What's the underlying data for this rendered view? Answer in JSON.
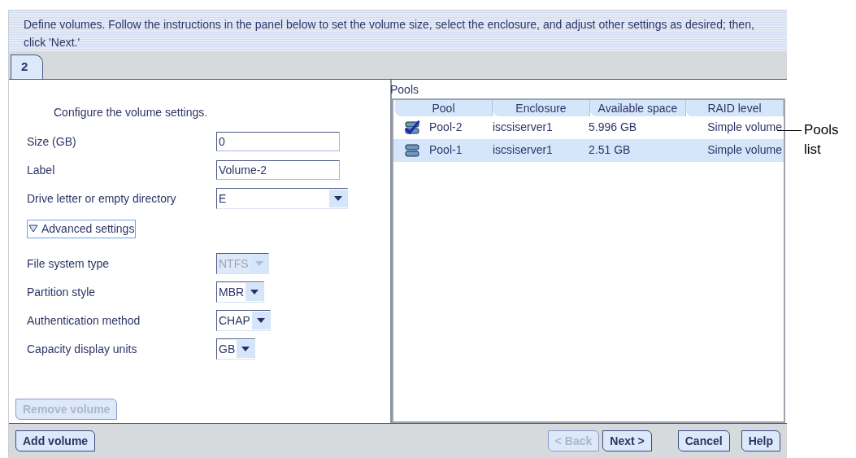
{
  "instructions": "Define volumes.  Follow the instructions in the panel below to set the volume size, select the enclosure, and adjust other settings as desired; then, click 'Next.'",
  "tabs": [
    {
      "label": "2",
      "selected": true
    }
  ],
  "settings": {
    "heading": "Configure the volume settings.",
    "fields": [
      {
        "kind": "text",
        "label": "Size (GB)",
        "value": "0"
      },
      {
        "kind": "text",
        "label": "Label",
        "value": "Volume-2"
      },
      {
        "kind": "dropdown",
        "label": "Drive letter or empty directory",
        "value": "E",
        "disabled": false
      }
    ],
    "advanced": {
      "label": "Advanced settings",
      "expanded": true,
      "fields": [
        {
          "kind": "dropdown",
          "label": "File system type",
          "value": "NTFS",
          "disabled": true
        },
        {
          "kind": "dropdown",
          "label": "Partition style",
          "value": "MBR",
          "disabled": false
        },
        {
          "kind": "dropdown",
          "label": "Authentication method",
          "value": "CHAP",
          "disabled": false
        },
        {
          "kind": "dropdown",
          "label": "Capacity display units",
          "value": "GB",
          "disabled": false
        }
      ]
    },
    "remove_button": {
      "label": "Remove volume",
      "disabled": true
    }
  },
  "pools": {
    "title": "Pools",
    "columns": [
      "Pool",
      "Enclosure",
      "Available space",
      "RAID level"
    ],
    "rows": [
      {
        "checked": true,
        "selected": false,
        "cells": [
          "Pool-2",
          "iscsiserver1",
          "5.996 GB",
          "Simple volume"
        ]
      },
      {
        "checked": false,
        "selected": true,
        "cells": [
          "Pool-1",
          "iscsiserver1",
          "2.51 GB",
          "Simple volume"
        ]
      }
    ]
  },
  "footer": {
    "left": [
      {
        "label": "Add volume",
        "disabled": false
      }
    ],
    "right": [
      {
        "label": "< Back",
        "disabled": true
      },
      {
        "label": "Next >",
        "disabled": false
      },
      {
        "label": "Cancel",
        "disabled": false
      },
      {
        "label": "Help",
        "disabled": false
      }
    ]
  },
  "callout": "Pools list"
}
